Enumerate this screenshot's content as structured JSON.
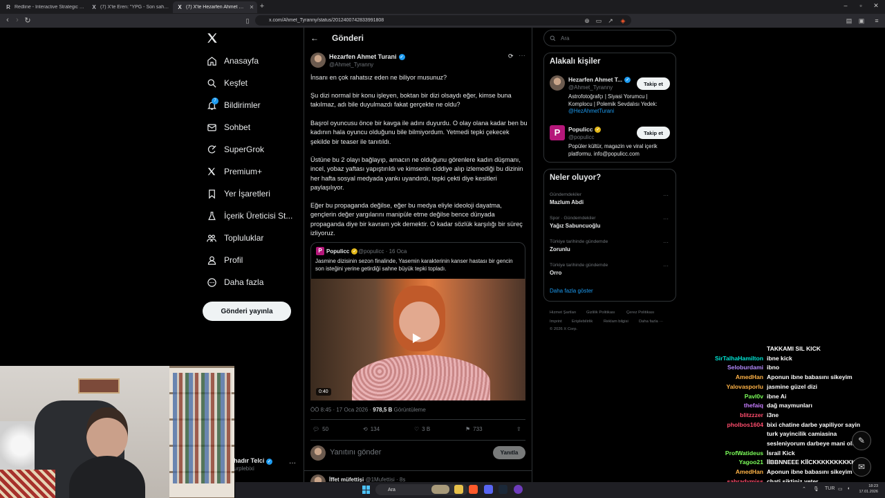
{
  "browser": {
    "tabs": [
      {
        "favicon": "R",
        "label": "Redline - Interactive Strategic Map",
        "active": false
      },
      {
        "favicon": "X",
        "label": "(7) X'te Eren: \"YPG - Son saha günceli",
        "active": false
      },
      {
        "favicon": "X",
        "label": "(7) X'te Hezarfen Ahmet Turani",
        "active": true
      }
    ],
    "url": "x.com/Ahmet_Tyranny/status/2012400742833991808"
  },
  "nav": {
    "items": [
      {
        "label": "Anasayfa",
        "icon": "home-icon"
      },
      {
        "label": "Keşfet",
        "icon": "search-icon"
      },
      {
        "label": "Bildirimler",
        "icon": "bell-icon",
        "badge": "7"
      },
      {
        "label": "Sohbet",
        "icon": "mail-icon"
      },
      {
        "label": "SuperGrok",
        "icon": "grok-icon"
      },
      {
        "label": "Premium+",
        "icon": "x-icon"
      },
      {
        "label": "Yer İşaretleri",
        "icon": "bookmark-icon"
      },
      {
        "label": "İçerik Üreticisi St...",
        "icon": "creator-studio-icon"
      },
      {
        "label": "Topluluklar",
        "icon": "communities-icon"
      },
      {
        "label": "Profil",
        "icon": "profile-icon"
      },
      {
        "label": "Daha fazla",
        "icon": "more-circle-icon"
      }
    ],
    "post_button": "Gönderi yayınla",
    "account": {
      "name": "hadır Telci",
      "handle": "urplebixi"
    }
  },
  "main": {
    "title": "Gönderi",
    "tweet": {
      "author": "Hezarfen Ahmet Turani",
      "handle": "@Ahmet_Tyranny",
      "paragraphs": [
        "İnsanı en çok rahatsız eden ne biliyor musunuz?",
        "Şu dizi normal bir konu işleyen, boktan bir dizi olsaydı eğer, kimse buna takılmaz, adı bile duyulmazdı fakat gerçekte ne oldu?",
        "Başrol oyuncusu önce bir kavga ile adını duyurdu. O olay olana kadar ben bu kadının hala oyuncu olduğunu bile bilmiyordum. Yetmedi tepki çekecek şekilde bir teaser ile tanıtıldı.",
        "Üstüne bu 2 olayı bağlayıp, amacın ne olduğunu görenlere kadın düşmanı, incel, yobaz yaftası yapıştırıldı ve kimsenin ciddiye alıp izlemediği bu dizinin her hafta sosyal medyada yankı uyandırdı, tepki çekti diye kesitleri paylaşılıyor.",
        "Eğer bu propaganda değilse, eğer bu medya eliyle ideoloji dayatma, gençlerin değer yargılarını manipüle etme değilse bence dünyada propaganda diye bir kavram yok demektir. O kadar sözlük karşılığı bir süreç izliyoruz."
      ],
      "quote": {
        "author": "Populicc",
        "handle_date": "@populicc · 16 Oca",
        "text": "Jasmine dizisinin sezon finalinde, Yasemin karakterinin kanser hastası bir gencin son isteğini yerine getirdiği sahne büyük tepki topladı.",
        "video_duration": "0:40"
      },
      "timestamp": "ÖÖ 8:45 · 17 Oca 2026 · ",
      "views": "978,5 B",
      "views_label": " Görüntüleme",
      "stats": {
        "replies": "50",
        "reposts": "134",
        "likes": "3 B",
        "bookmarks": "733"
      }
    },
    "reply": {
      "placeholder": "Yanıtını gönder",
      "button": "Yanıtla"
    },
    "next_reply": {
      "author": "İffet müfettişi",
      "meta": "@1Mufettisi · 8s"
    }
  },
  "sidebar": {
    "search_placeholder": "Ara",
    "related_title": "Alakalı kişiler",
    "related": [
      {
        "name": "Hezarfen Ahmet T...",
        "handle": "@Ahmet_Tyranny",
        "bio": "Astrofotoğrafçı | Siyasi Yorumcu | Komplocu | Polemik Sevdalısı Yedek: ",
        "bio_link": "@HezAhmetTurani",
        "follow": "Takip et",
        "verified": "blue"
      },
      {
        "name": "Populicc",
        "handle": "@populicc",
        "bio": "Popüler kültür, magazin ve viral içerik platformu. info@populicc.com",
        "bio_link": "",
        "follow": "Takip et",
        "verified": "gold"
      }
    ],
    "trends_title": "Neler oluyor?",
    "trends": [
      {
        "category": "Gündemdekiler",
        "name": "Mazlum Abdi"
      },
      {
        "category": "Spor · Gündemdekiler",
        "name": "Yağız Sabuncuoğlu"
      },
      {
        "category": "Türkiye tarihinde gündemde",
        "name": "Zorunlu"
      },
      {
        "category": "Türkiye tarihinde gündemde",
        "name": "Orro"
      }
    ],
    "show_more": "Daha fazla göster",
    "footer": [
      "Hizmet Şartları",
      "Gizlilik Politikası",
      "Çerez Politikası",
      "Imprint",
      "Erişilebilirlik",
      "Reklam bilgisi",
      "Daha fazla ···",
      "© 2026 X Corp."
    ]
  },
  "chat": [
    {
      "user": "",
      "user_color": "#b58cff",
      "msg": "TAKKAMI SIL KICK"
    },
    {
      "user": "SirTalhaHamilton",
      "user_color": "#00e5d4",
      "msg": "ibne kick"
    },
    {
      "user": "Seloburdami",
      "user_color": "#b58cff",
      "msg": "ibno"
    },
    {
      "user": "AmedHan",
      "user_color": "#ffb347",
      "msg": "Aponun ibne babasını sikeyim"
    },
    {
      "user": "Yalovasporlu",
      "user_color": "#ffb347",
      "msg": "jasmine güzel dizi"
    },
    {
      "user": "Pavl0v",
      "user_color": "#7cff5a",
      "msg": "ibne Ai"
    },
    {
      "user": "thefaiq",
      "user_color": "#c77dff",
      "msg": "dağ maymunları"
    },
    {
      "user": "blitzzzer",
      "user_color": "#ff4d6d",
      "msg": "i3ne"
    },
    {
      "user": "pholbos1604",
      "user_color": "#ff4d6d",
      "msg": "bixi chatine darbe yapiliyor sayin"
    },
    {
      "user": "",
      "user_color": "#ffffff",
      "msg": "turk yayincilik camiasina"
    },
    {
      "user": "",
      "user_color": "#ffffff",
      "msg": "sesleniyorum darbeye mani olun"
    },
    {
      "user": "ProfWatideus",
      "user_color": "#7cff5a",
      "msg": "İsrail Kick"
    },
    {
      "user": "Yagoo21",
      "user_color": "#7cff5a",
      "msg": "İİBBNNEEE KİİCKKKKKKKKKK"
    },
    {
      "user": "AmedHan",
      "user_color": "#ffb347",
      "msg": "Aponun ibne babasını sikeyim"
    },
    {
      "user": "sahradymiss",
      "user_color": "#ff4d6d",
      "msg": "chati siktiniz yeter"
    },
    {
      "user": "gokhanbuyuk",
      "user_color": "#4d7cff",
      "msg": ""
    }
  ],
  "taskbar": {
    "search": "Ara",
    "lang": "TUR",
    "time": "18:23",
    "date": "17.01.2026"
  }
}
